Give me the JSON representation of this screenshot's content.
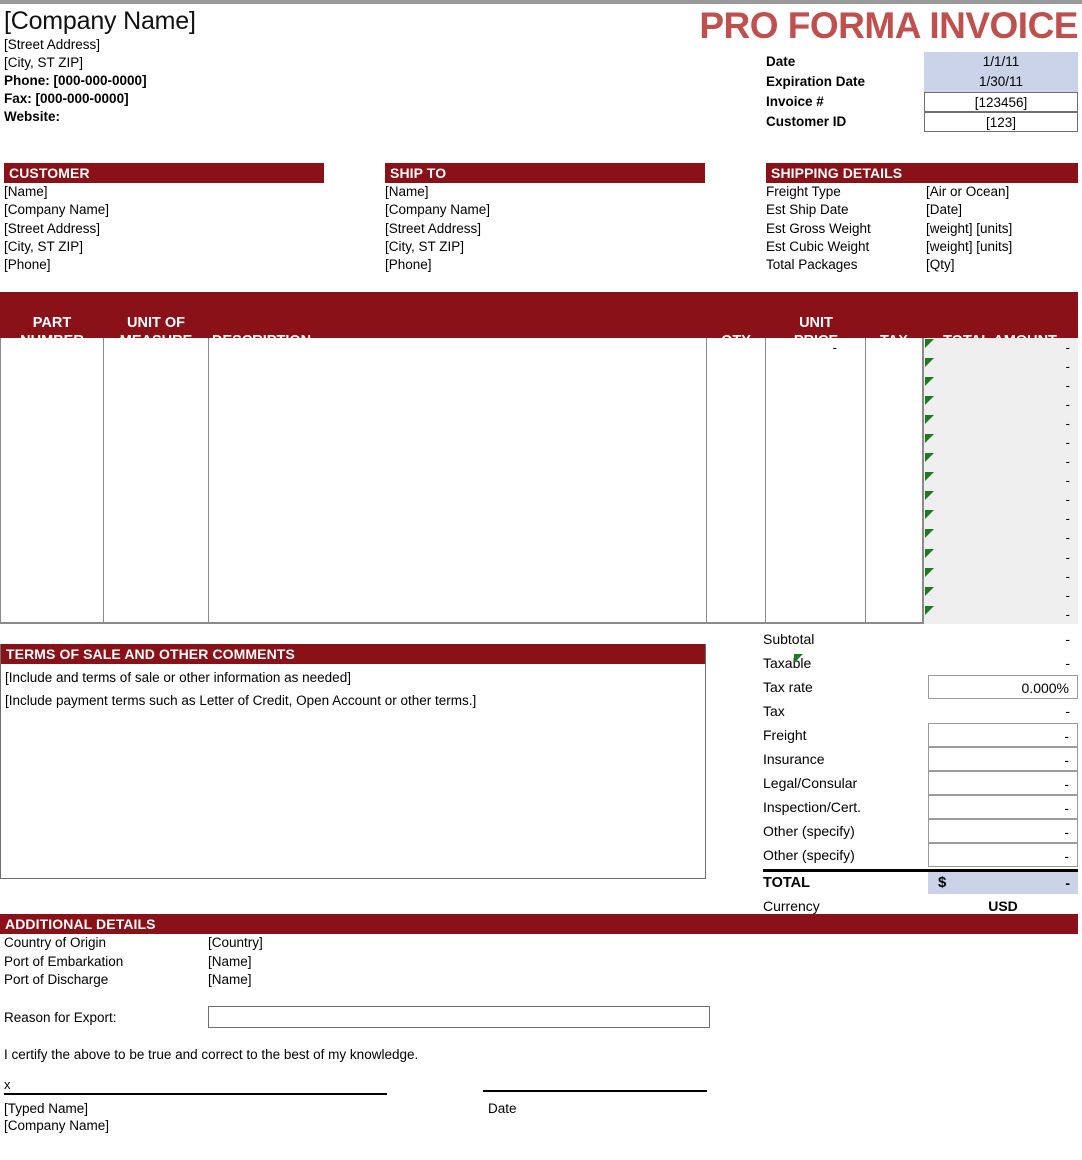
{
  "document": {
    "title": "PRO FORMA INVOICE",
    "title_color": "#c0504d",
    "accent_color": "#8b1118",
    "shade_color": "#cad3e8",
    "amount_col_color": "#efefef",
    "formula_marker_color": "#1e7a1e"
  },
  "company": {
    "name": "[Company Name]",
    "street": "[Street Address]",
    "city": "[City, ST  ZIP]",
    "phone": "Phone: [000-000-0000]",
    "fax": "Fax: [000-000-0000]",
    "website": "Website:"
  },
  "meta": {
    "rows": [
      {
        "label": "Date",
        "value": "1/1/11",
        "style": "shaded"
      },
      {
        "label": "Expiration Date",
        "value": "1/30/11",
        "style": "shaded"
      },
      {
        "label": "Invoice #",
        "value": "[123456]",
        "style": "boxed"
      },
      {
        "label": "Customer ID",
        "value": "[123]",
        "style": "boxed"
      }
    ]
  },
  "customer": {
    "header": "CUSTOMER",
    "lines": [
      "[Name]",
      "[Company Name]",
      "[Street Address]",
      "[City, ST  ZIP]",
      "[Phone]"
    ]
  },
  "ship_to": {
    "header": "SHIP TO",
    "lines": [
      "[Name]",
      "[Company Name]",
      "[Street Address]",
      "[City, ST  ZIP]",
      "[Phone]"
    ]
  },
  "shipping_details": {
    "header": "SHIPPING DETAILS",
    "rows": [
      {
        "label": "Freight Type",
        "value": "[Air or Ocean]"
      },
      {
        "label": "Est Ship Date",
        "value": "[Date]"
      },
      {
        "label": "Est Gross Weight",
        "value": "[weight] [units]"
      },
      {
        "label": "Est Cubic Weight",
        "value": "[weight] [units]"
      },
      {
        "label": "Total Packages",
        "value": "[Qty]"
      }
    ]
  },
  "items_table": {
    "columns": [
      {
        "line1": "PART",
        "line2": "NUMBER"
      },
      {
        "line1": "UNIT OF",
        "line2": "MEASURE"
      },
      {
        "line1": "",
        "line2": "DESCRIPTION"
      },
      {
        "line1": "",
        "line2": "QTY"
      },
      {
        "line1": "UNIT",
        "line2": "PRICE"
      },
      {
        "line1": "",
        "line2": "TAX"
      },
      {
        "line1": "",
        "line2": "TOTAL AMOUNT"
      }
    ],
    "row_count": 15,
    "unit_price_first_row": "-",
    "amount_placeholder": "-"
  },
  "terms": {
    "header": "TERMS OF SALE AND OTHER COMMENTS",
    "lines": [
      "[Include and terms of sale or other information as needed]",
      "[Include payment terms such as Letter of Credit, Open Account or other terms.]"
    ]
  },
  "totals": {
    "rows": [
      {
        "label": "Subtotal",
        "value": "-",
        "boxed": false,
        "marker": false
      },
      {
        "label": "Taxable",
        "value": "-",
        "boxed": false,
        "marker": true
      },
      {
        "label": "Tax rate",
        "value": "0.000%",
        "boxed": true,
        "marker": false
      },
      {
        "label": "Tax",
        "value": "-",
        "boxed": false,
        "marker": false
      },
      {
        "label": "Freight",
        "value": "-",
        "boxed": true,
        "marker": false
      },
      {
        "label": "Insurance",
        "value": "-",
        "boxed": true,
        "marker": false
      },
      {
        "label": "Legal/Consular",
        "value": "-",
        "boxed": true,
        "marker": false
      },
      {
        "label": "Inspection/Cert.",
        "value": "-",
        "boxed": true,
        "marker": false
      },
      {
        "label": "Other (specify)",
        "value": "-",
        "boxed": true,
        "marker": false
      },
      {
        "label": "Other (specify)",
        "value": "-",
        "boxed": true,
        "marker": false
      }
    ],
    "grand_label": "TOTAL",
    "grand_symbol": "$",
    "grand_value": "-",
    "currency_label": "Currency",
    "currency_value": "USD"
  },
  "additional": {
    "header": "ADDITIONAL DETAILS",
    "rows": [
      {
        "label": "Country of Origin",
        "value": "[Country]"
      },
      {
        "label": "Port of Embarkation",
        "value": "[Name]"
      },
      {
        "label": "Port of Discharge",
        "value": "[Name]"
      }
    ],
    "reason_label": "Reason for Export:",
    "reason_value": ""
  },
  "signature": {
    "certify": "I certify the above to be true and correct to the best of my knowledge.",
    "x_mark": "x",
    "typed_name": "[Typed Name]",
    "company": "[Company Name]",
    "date_label": "Date"
  }
}
